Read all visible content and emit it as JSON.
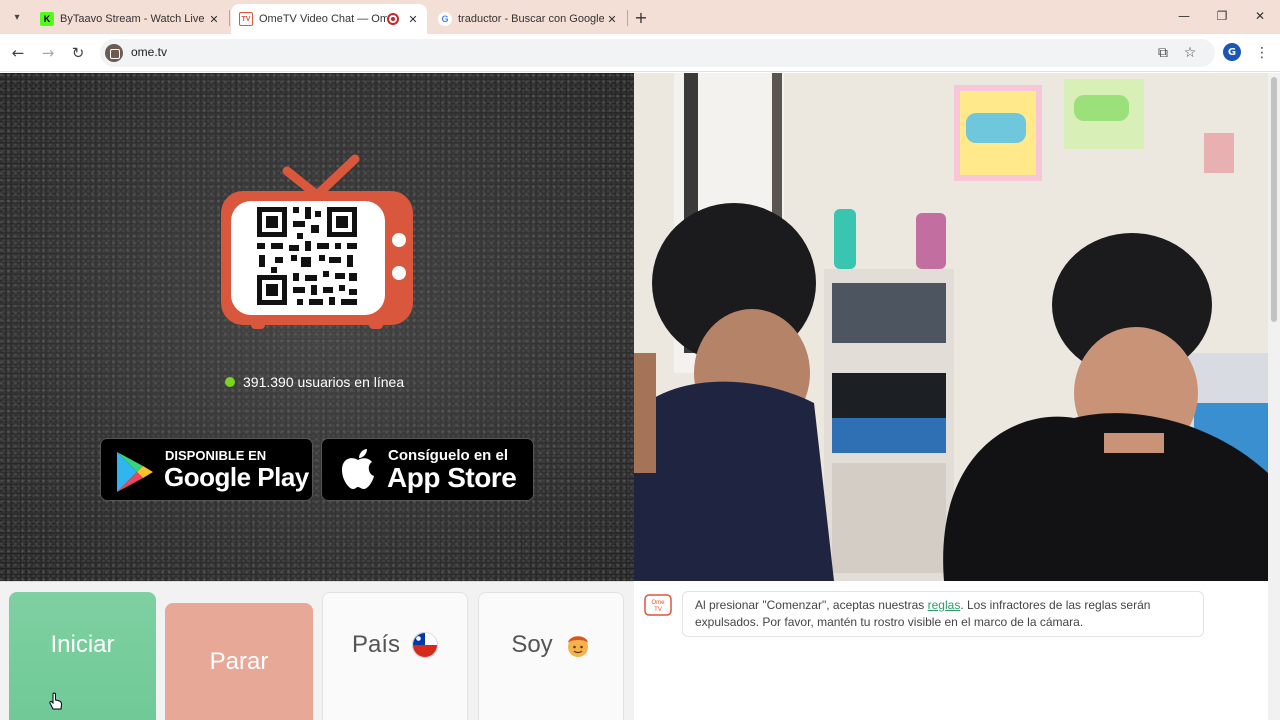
{
  "browser": {
    "tabs": [
      {
        "title": "ByTaavo Stream - Watch Live on",
        "favicon": "kick-icon",
        "active": false
      },
      {
        "title": "OmeTV Video Chat — Ome",
        "favicon": "ometv-icon",
        "active": true,
        "recording": true
      },
      {
        "title": "traductor - Buscar con Google",
        "favicon": "google-icon",
        "active": false
      }
    ],
    "url": "ome.tv",
    "profile_initial": "G"
  },
  "left_panel": {
    "online_count": "391.390 usuarios en línea",
    "google_play": {
      "small": "DISPONIBLE EN",
      "big": "Google Play"
    },
    "app_store": {
      "small": "Consíguelo en el",
      "big": "App Store"
    }
  },
  "controls": {
    "start": "Iniciar",
    "stop": "Parar",
    "country": "País",
    "country_flag": "chile-flag-icon",
    "gender": "Soy",
    "gender_icon": "boy-face-icon"
  },
  "chat": {
    "logo_text": "Ome TV",
    "message_before": "Al presionar \"Comenzar\", aceptas nuestras ",
    "message_link": "reglas",
    "message_after": ". Los infractores de las reglas serán expulsados. Por favor, mantén tu rostro visible en el marco de la cámara."
  },
  "colors": {
    "tabstrip": "#f3dfd6",
    "start_button": "#6ec995",
    "stop_button": "#e8a898",
    "tv_orange": "#d9573d",
    "online_dot": "#7ed321",
    "link": "#2a9d6a"
  }
}
